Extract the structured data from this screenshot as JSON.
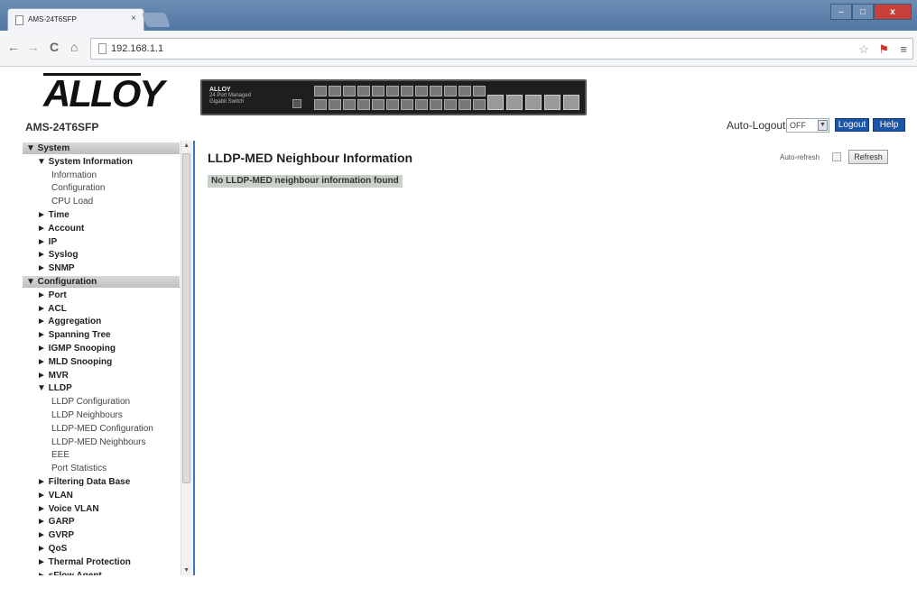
{
  "browser": {
    "tab_title": "AMS-24T6SFP",
    "tab_close": "×",
    "url": "192.168.1.1",
    "window_controls": {
      "minimize": "–",
      "maximize": "□",
      "close": "x"
    },
    "nav_icons": {
      "back": "←",
      "forward": "→",
      "reload": "C",
      "home": "⌂",
      "star": "☆",
      "extension": "⚑",
      "menu": "≡"
    }
  },
  "header": {
    "logo_text": "ALLOY",
    "model": "AMS-24T6SFP",
    "switch_brand": "ALLOY",
    "switch_subtitle": "24 Port Managed\nGigabit Switch",
    "auto_logout_label": "Auto-Logout",
    "auto_logout_value": "OFF",
    "logout_label": "Logout",
    "help_label": "Help"
  },
  "sidebar": {
    "items": [
      {
        "type": "section",
        "label": "▼ System"
      },
      {
        "type": "group",
        "indent": 1,
        "label": "▼ System Information"
      },
      {
        "type": "leaf",
        "indent": 2,
        "label": "Information"
      },
      {
        "type": "leaf",
        "indent": 2,
        "label": "Configuration"
      },
      {
        "type": "leaf",
        "indent": 2,
        "label": "CPU Load"
      },
      {
        "type": "group",
        "indent": 1,
        "label": "► Time"
      },
      {
        "type": "group",
        "indent": 1,
        "label": "► Account"
      },
      {
        "type": "group",
        "indent": 1,
        "label": "► IP"
      },
      {
        "type": "group",
        "indent": 1,
        "label": "► Syslog"
      },
      {
        "type": "group",
        "indent": 1,
        "label": "► SNMP"
      },
      {
        "type": "section",
        "label": "▼ Configuration"
      },
      {
        "type": "group",
        "indent": 1,
        "label": "► Port"
      },
      {
        "type": "group",
        "indent": 1,
        "label": "► ACL"
      },
      {
        "type": "group",
        "indent": 1,
        "label": "► Aggregation"
      },
      {
        "type": "group",
        "indent": 1,
        "label": "► Spanning Tree"
      },
      {
        "type": "group",
        "indent": 1,
        "label": "► IGMP Snooping"
      },
      {
        "type": "group",
        "indent": 1,
        "label": "► MLD Snooping"
      },
      {
        "type": "group",
        "indent": 1,
        "label": "► MVR"
      },
      {
        "type": "group",
        "indent": 1,
        "label": "▼ LLDP"
      },
      {
        "type": "leaf",
        "indent": 2,
        "label": "LLDP Configuration"
      },
      {
        "type": "leaf",
        "indent": 2,
        "label": "LLDP Neighbours"
      },
      {
        "type": "leaf",
        "indent": 2,
        "label": "LLDP-MED Configuration"
      },
      {
        "type": "leaf",
        "indent": 2,
        "label": "LLDP-MED Neighbours"
      },
      {
        "type": "leaf",
        "indent": 2,
        "label": "EEE"
      },
      {
        "type": "leaf",
        "indent": 2,
        "label": "Port Statistics"
      },
      {
        "type": "group",
        "indent": 1,
        "label": "► Filtering Data Base"
      },
      {
        "type": "group",
        "indent": 1,
        "label": "► VLAN"
      },
      {
        "type": "group",
        "indent": 1,
        "label": "► Voice VLAN"
      },
      {
        "type": "group",
        "indent": 1,
        "label": "► GARP"
      },
      {
        "type": "group",
        "indent": 1,
        "label": "► GVRP"
      },
      {
        "type": "group",
        "indent": 1,
        "label": "► QoS"
      },
      {
        "type": "group",
        "indent": 1,
        "label": "► Thermal Protection"
      },
      {
        "type": "group",
        "indent": 1,
        "label": "► sFlow Agent"
      }
    ]
  },
  "main": {
    "title": "LLDP-MED Neighbour Information",
    "notice": "No LLDP-MED neighbour information found",
    "auto_refresh_label": "Auto-refresh",
    "refresh_label": "Refresh"
  },
  "colors": {
    "accent": "#1a55a8",
    "sidebar_divider": "#3a78c2",
    "notice_bg": "#c8d0c8",
    "titlebar": "#5a7ea8"
  }
}
